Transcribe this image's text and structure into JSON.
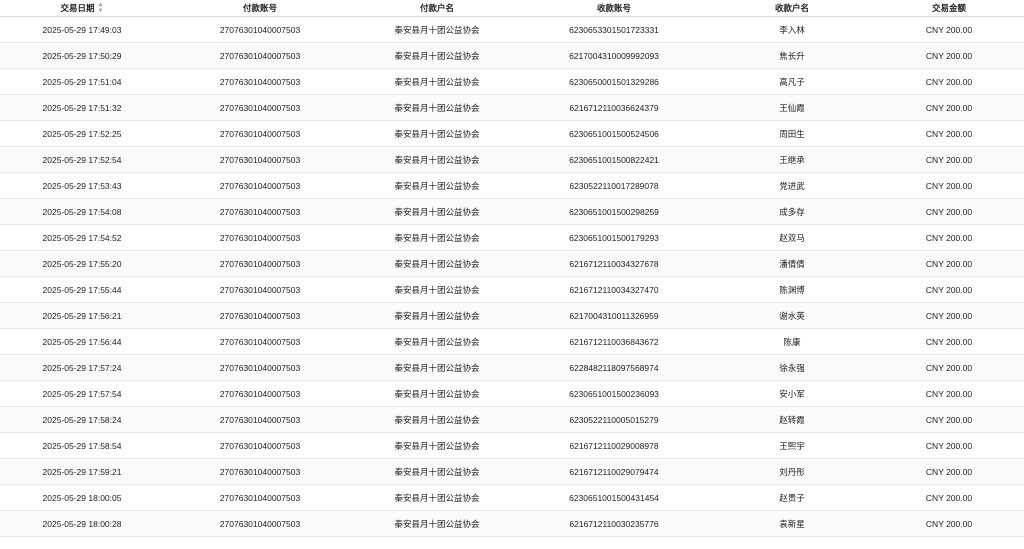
{
  "headers": [
    "交易日期",
    "付款账号",
    "付款户名",
    "收款账号",
    "收款户名",
    "交易金额"
  ],
  "sort_icon": "sort-icon",
  "rows": [
    [
      "2025-05-29 17:49:03",
      "27076301040007503",
      "秦安县月十团公益协会",
      "6230653301501723331",
      "李入林",
      "CNY 200.00"
    ],
    [
      "2025-05-29 17:50:29",
      "27076301040007503",
      "秦安县月十团公益协会",
      "6217004310009992093",
      "焦长升",
      "CNY 200.00"
    ],
    [
      "2025-05-29 17:51:04",
      "27076301040007503",
      "秦安县月十团公益协会",
      "6230650001501329286",
      "高凡子",
      "CNY 200.00"
    ],
    [
      "2025-05-29 17:51:32",
      "27076301040007503",
      "秦安县月十团公益协会",
      "6216712110036624379",
      "王仙霞",
      "CNY 200.00"
    ],
    [
      "2025-05-29 17:52:25",
      "27076301040007503",
      "秦安县月十团公益协会",
      "6230651001500524506",
      "周田生",
      "CNY 200.00"
    ],
    [
      "2025-05-29 17:52:54",
      "27076301040007503",
      "秦安县月十团公益协会",
      "6230651001500822421",
      "王继承",
      "CNY 200.00"
    ],
    [
      "2025-05-29 17:53:43",
      "27076301040007503",
      "秦安县月十团公益协会",
      "6230522110017289078",
      "党进武",
      "CNY 200.00"
    ],
    [
      "2025-05-29 17:54:08",
      "27076301040007503",
      "秦安县月十团公益协会",
      "6230651001500298259",
      "成多存",
      "CNY 200.00"
    ],
    [
      "2025-05-29 17:54:52",
      "27076301040007503",
      "秦安县月十团公益协会",
      "6230651001500179293",
      "赵双马",
      "CNY 200.00"
    ],
    [
      "2025-05-29 17:55:20",
      "27076301040007503",
      "秦安县月十团公益协会",
      "6216712110034327678",
      "潘倩倩",
      "CNY 200.00"
    ],
    [
      "2025-05-29 17:55:44",
      "27076301040007503",
      "秦安县月十团公益协会",
      "6216712110034327470",
      "陈渊博",
      "CNY 200.00"
    ],
    [
      "2025-05-29 17:56:21",
      "27076301040007503",
      "秦安县月十团公益协会",
      "6217004310011326959",
      "谢水英",
      "CNY 200.00"
    ],
    [
      "2025-05-29 17:56:44",
      "27076301040007503",
      "秦安县月十团公益协会",
      "6216712110036843672",
      "陈康",
      "CNY 200.00"
    ],
    [
      "2025-05-29 17:57:24",
      "27076301040007503",
      "秦安县月十团公益协会",
      "6228482118097568974",
      "徐永强",
      "CNY 200.00"
    ],
    [
      "2025-05-29 17:57:54",
      "27076301040007503",
      "秦安县月十团公益协会",
      "6230651001500236093",
      "安小军",
      "CNY 200.00"
    ],
    [
      "2025-05-29 17:58:24",
      "27076301040007503",
      "秦安县月十团公益协会",
      "6230522110005015279",
      "赵转霞",
      "CNY 200.00"
    ],
    [
      "2025-05-29 17:58:54",
      "27076301040007503",
      "秦安县月十团公益协会",
      "6216712110029008978",
      "王熙宇",
      "CNY 200.00"
    ],
    [
      "2025-05-29 17:59:21",
      "27076301040007503",
      "秦安县月十团公益协会",
      "6216712110029079474",
      "刘丹彤",
      "CNY 200.00"
    ],
    [
      "2025-05-29 18:00:05",
      "27076301040007503",
      "秦安县月十团公益协会",
      "6230651001500431454",
      "赵贵子",
      "CNY 200.00"
    ],
    [
      "2025-05-29 18:00:28",
      "27076301040007503",
      "秦安县月十团公益协会",
      "6216712110030235776",
      "袁新星",
      "CNY 200.00"
    ]
  ]
}
